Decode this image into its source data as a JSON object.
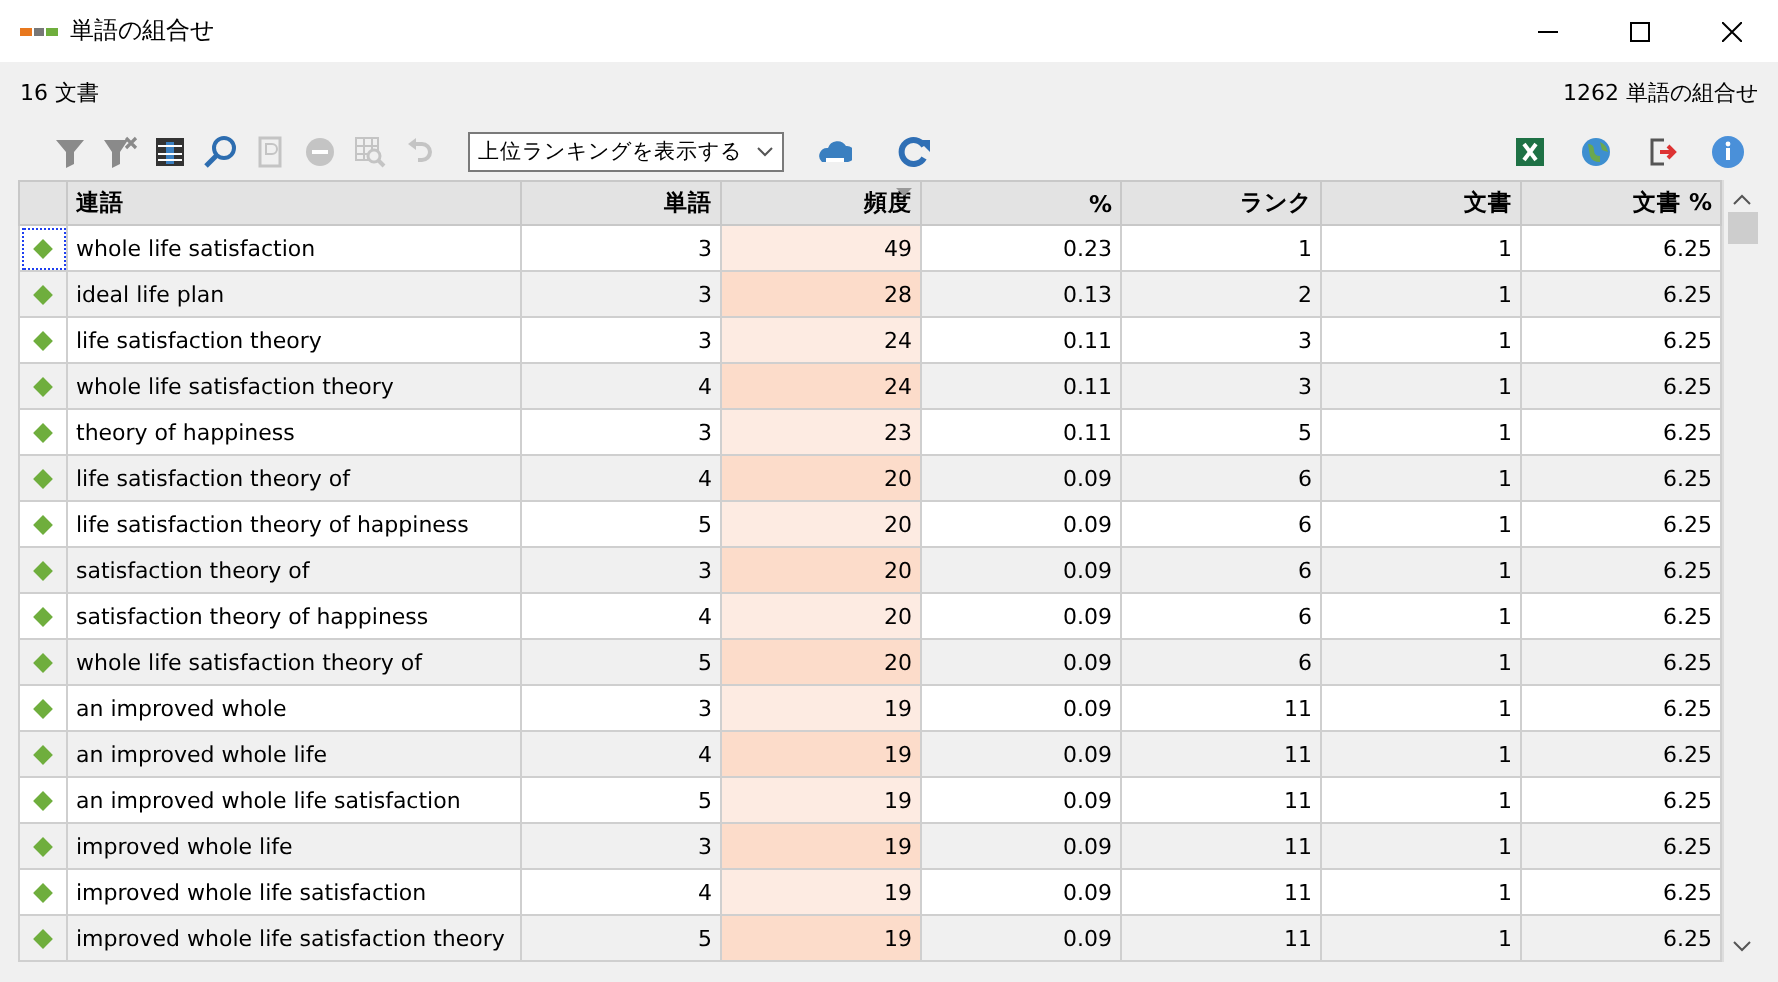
{
  "window": {
    "title": "単語の組合せ"
  },
  "summary": {
    "documents": "16 文書",
    "combinations": "1262 単語の組合せ"
  },
  "toolbar": {
    "left": [
      {
        "kind": "filter",
        "disabled": false
      },
      {
        "kind": "filter-clear",
        "disabled": false
      },
      {
        "kind": "columns",
        "disabled": false
      },
      {
        "kind": "search",
        "disabled": false
      },
      {
        "kind": "doc",
        "disabled": true
      },
      {
        "kind": "remove",
        "disabled": true
      },
      {
        "kind": "grid-search",
        "disabled": true
      },
      {
        "kind": "undo",
        "disabled": true
      }
    ],
    "dropdown": {
      "value": "上位ランキングを表示する"
    },
    "middle": [
      {
        "kind": "cloud"
      },
      {
        "kind": "refresh"
      }
    ],
    "right": [
      {
        "kind": "excel"
      },
      {
        "kind": "globe"
      },
      {
        "kind": "export"
      },
      {
        "kind": "info"
      }
    ]
  },
  "table": {
    "columns": [
      {
        "label": "連語",
        "sorted": false
      },
      {
        "label": "単語",
        "sorted": false
      },
      {
        "label": "頻度",
        "sorted": true
      },
      {
        "label": "%",
        "sorted": false
      },
      {
        "label": "ランク",
        "sorted": false
      },
      {
        "label": "文書",
        "sorted": false
      },
      {
        "label": "文書 %",
        "sorted": false
      }
    ],
    "rows": [
      {
        "focused": true,
        "cells": [
          "whole life satisfaction",
          "3",
          "49",
          "0.23",
          "1",
          "1",
          "6.25"
        ]
      },
      {
        "focused": false,
        "cells": [
          "ideal life plan",
          "3",
          "28",
          "0.13",
          "2",
          "1",
          "6.25"
        ]
      },
      {
        "focused": false,
        "cells": [
          "life satisfaction theory",
          "3",
          "24",
          "0.11",
          "3",
          "1",
          "6.25"
        ]
      },
      {
        "focused": false,
        "cells": [
          "whole life satisfaction theory",
          "4",
          "24",
          "0.11",
          "3",
          "1",
          "6.25"
        ]
      },
      {
        "focused": false,
        "cells": [
          "theory of happiness",
          "3",
          "23",
          "0.11",
          "5",
          "1",
          "6.25"
        ]
      },
      {
        "focused": false,
        "cells": [
          "life satisfaction theory of",
          "4",
          "20",
          "0.09",
          "6",
          "1",
          "6.25"
        ]
      },
      {
        "focused": false,
        "cells": [
          "life satisfaction theory of happiness",
          "5",
          "20",
          "0.09",
          "6",
          "1",
          "6.25"
        ]
      },
      {
        "focused": false,
        "cells": [
          "satisfaction theory of",
          "3",
          "20",
          "0.09",
          "6",
          "1",
          "6.25"
        ]
      },
      {
        "focused": false,
        "cells": [
          "satisfaction theory of happiness",
          "4",
          "20",
          "0.09",
          "6",
          "1",
          "6.25"
        ]
      },
      {
        "focused": false,
        "cells": [
          "whole life satisfaction theory of",
          "5",
          "20",
          "0.09",
          "6",
          "1",
          "6.25"
        ]
      },
      {
        "focused": false,
        "cells": [
          "an improved whole",
          "3",
          "19",
          "0.09",
          "11",
          "1",
          "6.25"
        ]
      },
      {
        "focused": false,
        "cells": [
          "an improved whole life",
          "4",
          "19",
          "0.09",
          "11",
          "1",
          "6.25"
        ]
      },
      {
        "focused": false,
        "cells": [
          "an improved whole life satisfaction",
          "5",
          "19",
          "0.09",
          "11",
          "1",
          "6.25"
        ]
      },
      {
        "focused": false,
        "cells": [
          "improved whole life",
          "3",
          "19",
          "0.09",
          "11",
          "1",
          "6.25"
        ]
      },
      {
        "focused": false,
        "cells": [
          "improved whole life satisfaction",
          "4",
          "19",
          "0.09",
          "11",
          "1",
          "6.25"
        ]
      },
      {
        "focused": false,
        "cells": [
          "improved whole life satisfaction theory",
          "5",
          "19",
          "0.09",
          "11",
          "1",
          "6.25"
        ]
      }
    ]
  }
}
